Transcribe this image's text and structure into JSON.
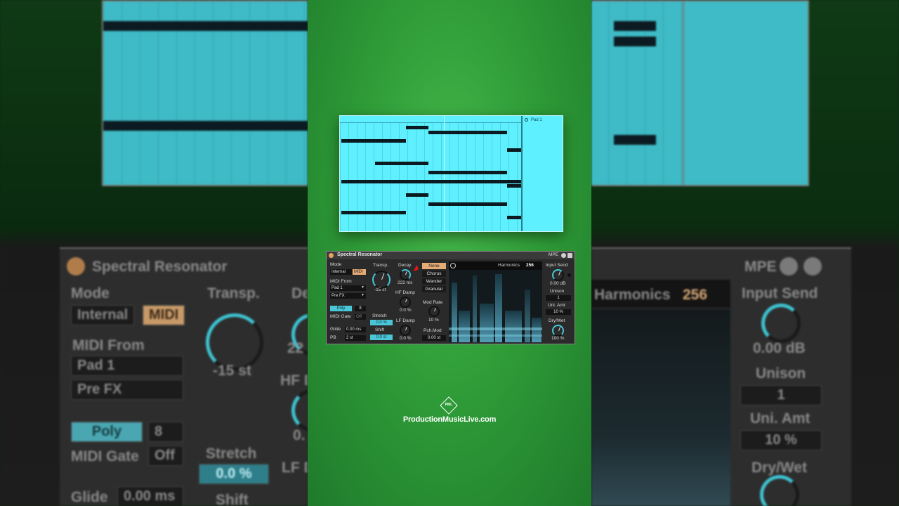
{
  "device": {
    "title": "Spectral Resonator",
    "mpe_label": "MPE",
    "mode_label": "Mode",
    "mode_internal": "Internal",
    "mode_midi": "MIDI",
    "midi_from_label": "MIDI From",
    "midi_from_value": "Pad 1",
    "midi_from_sub": "Pre FX",
    "poly_label": "Poly",
    "poly_voices": "8",
    "midi_gate_label": "MIDI Gate",
    "midi_gate_value": "Off",
    "glide_label": "Glide",
    "glide_value": "0.00 ms",
    "pb_label": "PB",
    "pb_value": "2 st",
    "transp_label": "Transp.",
    "transp_value": "-15 st",
    "stretch_label": "Stretch",
    "stretch_value": "0.0 %",
    "shift_label": "Shift",
    "shift_value": "0.0 st",
    "decay_label": "Decay",
    "decay_value": "222 ms",
    "hf_damp_label": "HF Damp",
    "hf_damp_value": "0.0 %",
    "lf_damp_label": "LF Damp",
    "lf_damp_value": "0.0 %",
    "mod_modes": [
      "None",
      "Chorus",
      "Wander",
      "Granular"
    ],
    "mod_selected": "None",
    "mod_rate_label": "Mod Rate",
    "mod_rate_value": "10 %",
    "pch_mod_label": "Pch.Mod",
    "pch_mod_value": "0.00 st",
    "harmonics_label": "Harmonics",
    "harmonics_value": "256",
    "input_send_label": "Input Send",
    "input_send_value": "0.00 dB",
    "unison_label": "Unison",
    "unison_value": "1",
    "uni_amt_label": "Uni. Amt",
    "uni_amt_value": "10 %",
    "dry_wet_label": "Dry/Wet",
    "dry_wet_value": "100 %"
  },
  "clip": {
    "pad_label": "Pad 1"
  },
  "bg": {
    "title": "Spectral Resonator",
    "mode": "Mode",
    "internal": "Internal",
    "midi": "MIDI",
    "midi_from": "MIDI From",
    "pad1": "Pad 1",
    "prefx": "Pre FX",
    "poly": "Poly",
    "voices": "8",
    "midi_gate": "MIDI Gate",
    "off": "Off",
    "glide": "Glide",
    "glide_val": "0.00 ms",
    "transp": "Transp.",
    "transp_val": "-15 st",
    "de": "De",
    "val_22": "22",
    "hf_d": "HF D",
    "o_dot": "0.",
    "lf_d": "LF D",
    "stretch": "Stretch",
    "stretch_val": "0.0 %",
    "shift": "Shift",
    "mpe": "MPE",
    "harmonics": "Harmonics",
    "harmonics_val": "256",
    "input_send": "Input Send",
    "input_send_val": "0.00 dB",
    "unison": "Unison",
    "unison_val": "1",
    "uni_amt": "Uni. Amt",
    "uni_amt_val": "10 %",
    "dry_wet": "Dry/Wet"
  },
  "branding": {
    "logo_mark": "PML",
    "site": "ProductionMusicLive.com"
  },
  "colors": {
    "accent_cyan": "#44c6d6",
    "accent_orange": "#e6ab74",
    "green": "#2f9c38",
    "clip": "#5ef0ff"
  }
}
